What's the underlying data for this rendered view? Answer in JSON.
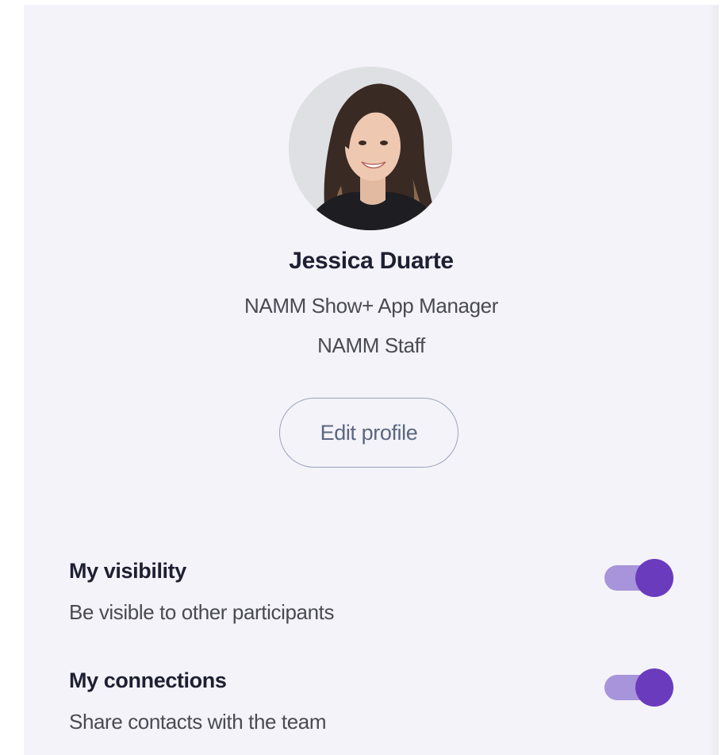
{
  "profile": {
    "name": "Jessica Duarte",
    "job_title": "NAMM Show+ App Manager",
    "organization": "NAMM Staff",
    "edit_label": "Edit profile"
  },
  "settings": [
    {
      "title": "My visibility",
      "description": "Be visible to other participants",
      "enabled": true
    },
    {
      "title": "My connections",
      "description": "Share contacts with the team",
      "enabled": true
    }
  ],
  "colors": {
    "panel_background": "#f4f3f9",
    "toggle_track_on": "#a794da",
    "toggle_thumb_on": "#6a3bbd",
    "button_border": "#9aa3bb",
    "button_text": "#5b6780"
  }
}
